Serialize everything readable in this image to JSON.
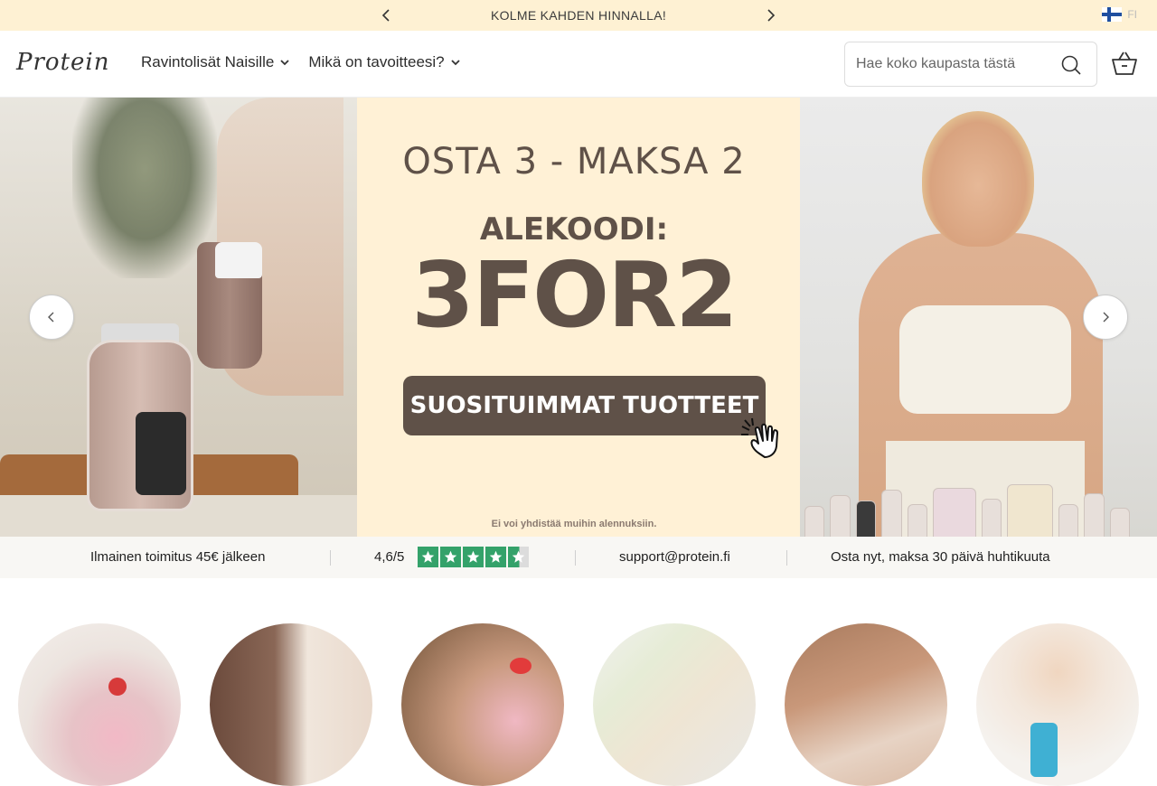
{
  "announcement": {
    "text": "KOLME KAHDEN HINNALLA!",
    "lang_code": "FI"
  },
  "header": {
    "logo_text": "Protein",
    "nav": [
      {
        "label": "Ravintolisät Naisille"
      },
      {
        "label": "Mikä on tavoitteesi?"
      }
    ],
    "search": {
      "placeholder": "Hae koko kaupasta tästä",
      "value": ""
    },
    "cart_icon": "basket-icon"
  },
  "hero": {
    "title": "OSTA 3 - MAKSA 2",
    "code_label": "ALEKOODI:",
    "code": "3FOR2",
    "cta": "SUOSITUIMMAT TUOTTEET",
    "note": "Ei voi yhdistää muihin alennuksiin."
  },
  "usp": {
    "shipping": "Ilmainen toimitus 45€ jälkeen",
    "rating": "4,6/5",
    "rating_value": 4.6,
    "rating_max": 5,
    "email": "support@protein.fi",
    "payment": "Osta nyt, maksa 30 päivä huhtikuuta"
  },
  "categories": [
    {
      "name": "category-strawberry-shake"
    },
    {
      "name": "category-women-duo"
    },
    {
      "name": "category-pink-drink"
    },
    {
      "name": "category-sachets"
    },
    {
      "name": "category-supplement-jar"
    },
    {
      "name": "category-shakers"
    }
  ],
  "colors": {
    "announcement_bg": "#fef1d3",
    "hero_center_bg": "#fff1d6",
    "brand_brown": "#5f5148",
    "trustpilot_green": "#34a26a"
  }
}
